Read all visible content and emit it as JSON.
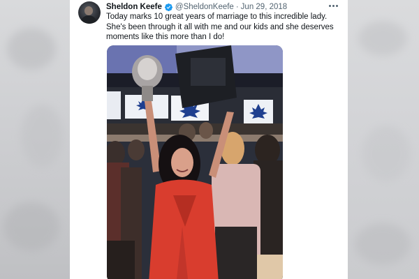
{
  "tweet": {
    "author_name": "Sheldon Keefe",
    "handle": "@SheldonKeefe",
    "separator": "·",
    "date": "Jun 29, 2018",
    "text": "Today marks 10 great years of marriage to this incredible lady. She's been through it all with me and our kids and she deserves moments like this more than I do!",
    "verified": true
  },
  "icons": {
    "verified": "verified-badge-icon",
    "more": "more-options-icon"
  },
  "colors": {
    "verified_blue": "#1d9bf0",
    "secondary_text": "#536471",
    "primary_text": "#0f1419"
  }
}
